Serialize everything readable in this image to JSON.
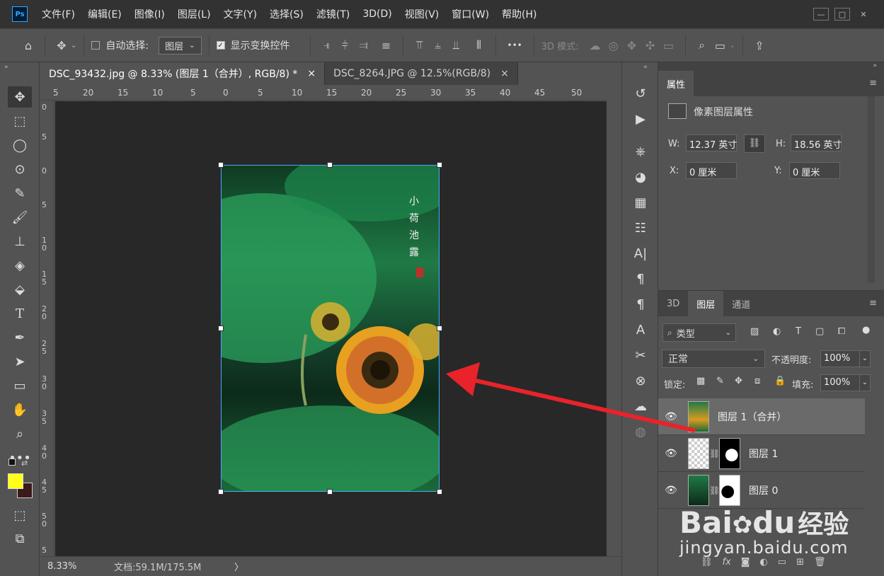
{
  "app": {
    "logo": "Ps"
  },
  "menu": [
    "文件(F)",
    "编辑(E)",
    "图像(I)",
    "图层(L)",
    "文字(Y)",
    "选择(S)",
    "滤镜(T)",
    "3D(D)",
    "视图(V)",
    "窗口(W)",
    "帮助(H)"
  ],
  "window_controls": {
    "minimize": "—",
    "maximize": "□",
    "close": "✕"
  },
  "options_bar": {
    "auto_select_label": "自动选择:",
    "auto_select_target": "图层",
    "show_transform_label": "显示变换控件",
    "more": "•••",
    "mode_3d_label": "3D 模式:"
  },
  "tabs": [
    {
      "label": "DSC_93432.jpg @ 8.33% (图层 1（合并）, RGB/8) *",
      "close": "×",
      "active": true
    },
    {
      "label": "DSC_8264.JPG @ 12.5%(RGB/8)",
      "close": "×",
      "active": false
    }
  ],
  "ruler_h": [
    "5",
    "20",
    "15",
    "10",
    "5",
    "0",
    "5",
    "10",
    "15",
    "20",
    "25",
    "30",
    "35",
    "40",
    "45",
    "50"
  ],
  "ruler_v": [
    "0",
    "5",
    "0",
    "5",
    "1\n0",
    "1\n5",
    "2\n0",
    "2\n5",
    "3\n0",
    "3\n5",
    "4\n0",
    "4\n5",
    "5\n0",
    "5"
  ],
  "image_text": {
    "poem": "小荷池露"
  },
  "status": {
    "zoom": "8.33%",
    "doc": "文档:59.1M/175.5M",
    "arrow": "〉"
  },
  "properties": {
    "tab": "属性",
    "subtitle": "像素图层属性",
    "w_label": "W:",
    "w_value": "12.37 英寸",
    "h_label": "H:",
    "h_value": "18.56 英寸",
    "x_label": "X:",
    "x_value": "0 厘米",
    "y_label": "Y:",
    "y_value": "0 厘米"
  },
  "layers_panel": {
    "tabs": [
      "3D",
      "图层",
      "通道"
    ],
    "active_tab": "图层",
    "filter_label": "类型",
    "blend_mode": "正常",
    "opacity_label": "不透明度:",
    "opacity_value": "100%",
    "lock_label": "锁定:",
    "fill_label": "填充:",
    "fill_value": "100%",
    "layers": [
      {
        "name": "图层 1（合并）",
        "visible": true,
        "active": true
      },
      {
        "name": "图层 1",
        "visible": true,
        "active": false
      },
      {
        "name": "图层 0",
        "visible": true,
        "active": false
      }
    ]
  },
  "watermark": {
    "brand": "Bai",
    "brand2": "du",
    "suffix": "经验",
    "url": "jingyan.baidu.com"
  },
  "colors": {
    "foreground": "#ffff1a",
    "background": "#3a1a1a",
    "arrow": "#e8232a"
  }
}
